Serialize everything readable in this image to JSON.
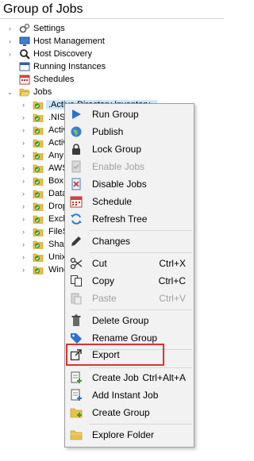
{
  "window": {
    "title": "Group of Jobs"
  },
  "tree": {
    "top_items": [
      {
        "label": "Settings",
        "icon": "gears-icon"
      },
      {
        "label": "Host Management",
        "icon": "monitor-icon"
      },
      {
        "label": "Host Discovery",
        "icon": "magnifier-icon"
      },
      {
        "label": "Running Instances",
        "icon": "window-icon"
      },
      {
        "label": "Schedules",
        "icon": "calendar-icon"
      },
      {
        "label": "Jobs",
        "icon": "folder-open-icon"
      }
    ],
    "jobs": [
      ".Active Directory Inventory",
      ".NIS",
      "Activ",
      "Activ",
      "Any",
      "AWS",
      "Box",
      "Data",
      "Drop",
      "Exch",
      "FileS",
      "Shar",
      "Unix",
      "Wind"
    ]
  },
  "context_menu": {
    "items": {
      "run_group": {
        "label": "Run Group",
        "icon": "play-icon"
      },
      "publish": {
        "label": "Publish",
        "icon": "globe-icon"
      },
      "lock_group": {
        "label": "Lock Group",
        "icon": "lock-icon"
      },
      "enable_jobs": {
        "label": "Enable Jobs",
        "icon": "enable-icon"
      },
      "disable_jobs": {
        "label": "Disable Jobs",
        "icon": "disable-icon"
      },
      "schedule": {
        "label": "Schedule",
        "icon": "calendar-icon"
      },
      "refresh_tree": {
        "label": "Refresh Tree",
        "icon": "refresh-icon"
      },
      "changes": {
        "label": "Changes",
        "icon": "pencil-icon"
      },
      "cut": {
        "label": "Cut",
        "shortcut": "Ctrl+X",
        "icon": "scissors-icon"
      },
      "copy": {
        "label": "Copy",
        "shortcut": "Ctrl+C",
        "icon": "copy-icon"
      },
      "paste": {
        "label": "Paste",
        "shortcut": "Ctrl+V",
        "icon": "paste-icon"
      },
      "delete_group": {
        "label": "Delete Group",
        "icon": "trash-icon"
      },
      "rename_group": {
        "label": "Rename Group",
        "icon": "tag-icon"
      },
      "export": {
        "label": "Export",
        "icon": "export-icon"
      },
      "create_job": {
        "label": "Create Job",
        "shortcut": "Ctrl+Alt+A",
        "icon": "new-job-icon"
      },
      "add_instant_job": {
        "label": "Add Instant Job",
        "icon": "instant-job-icon"
      },
      "create_group": {
        "label": "Create Group",
        "icon": "new-folder-icon"
      },
      "explore_folder": {
        "label": "Explore Folder",
        "icon": "folder-icon"
      }
    }
  },
  "colors": {
    "highlight_box": "#e03030",
    "selection": "#cce8ff",
    "folder": "#e8c04a",
    "check": "#3a9a2a"
  }
}
